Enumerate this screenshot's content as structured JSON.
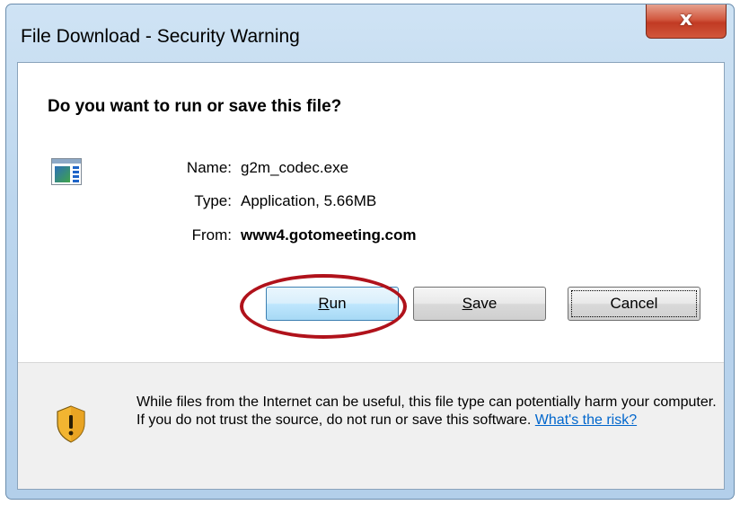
{
  "window": {
    "title": "File Download - Security Warning",
    "close_glyph": "x"
  },
  "dialog": {
    "question": "Do you want to run or save this file?",
    "file_icon": "application-window-icon",
    "fields": {
      "name_label": "Name:",
      "name_value": "g2m_codec.exe",
      "type_label": "Type:",
      "type_value": "Application, 5.66MB",
      "from_label": "From:",
      "from_value": "www4.gotomeeting.com"
    },
    "buttons": {
      "run_mnemonic": "R",
      "run_rest": "un",
      "save_mnemonic": "S",
      "save_rest": "ave",
      "cancel_label": "Cancel"
    },
    "highlight": {
      "target": "run-button",
      "color": "#b0121b"
    }
  },
  "warning": {
    "icon": "shield-warning-icon",
    "text": "While files from the Internet can be useful, this file type can potentially harm your computer. If you do not trust the source, do not run or save this software.",
    "link_text": "What's the risk?",
    "link_color": "#0066cc"
  },
  "colors": {
    "frame": "#bcd6ee",
    "close_button": "#c94a33",
    "run_button": "#bee6fd"
  }
}
